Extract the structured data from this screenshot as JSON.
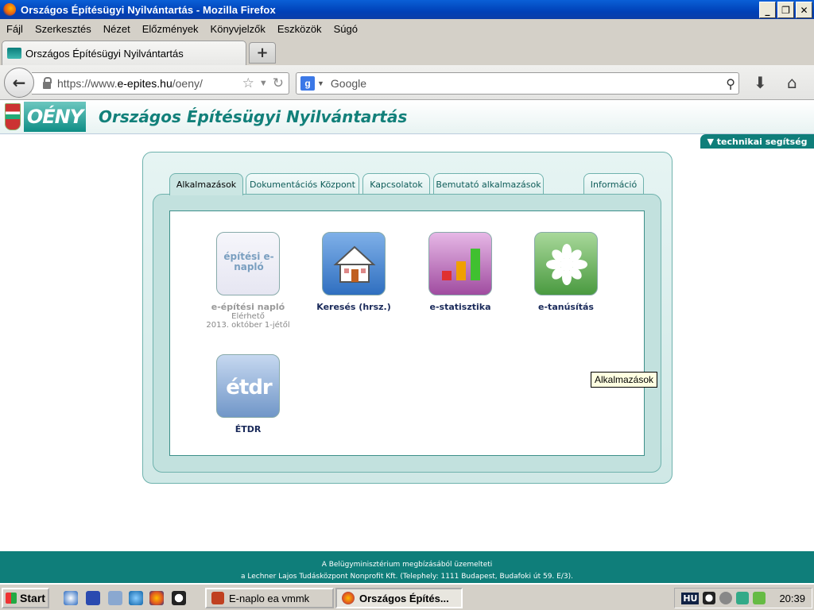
{
  "window": {
    "title": "Országos Építésügyi Nyilvántartás - Mozilla Firefox"
  },
  "menu": [
    "Fájl",
    "Szerkesztés",
    "Nézet",
    "Előzmények",
    "Könyvjelzők",
    "Eszközök",
    "Súgó"
  ],
  "tabs": {
    "active_title": "Országos Építésügyi Nyilvántartás",
    "new_tab": "+"
  },
  "address": {
    "proto": "https://www.",
    "host": "e-epites.hu",
    "path": "/oeny/"
  },
  "search": {
    "placeholder": "Google",
    "engine": "g"
  },
  "site": {
    "logo": "OÉNY",
    "title": "Országos Építésügyi Nyilvántartás",
    "help": "▼ technikai segítség"
  },
  "panel_tabs": [
    "Alkalmazások",
    "Dokumentációs Központ",
    "Kapcsolatok",
    "Bemutató alkalmazások",
    "Információ"
  ],
  "apps": [
    {
      "label": "e-építési napló",
      "sub1": "Elérhető",
      "sub2": "2013. október 1-jétől",
      "icon_text": "építési e-napló"
    },
    {
      "label": "Keresés (hrsz.)"
    },
    {
      "label": "e-statisztika"
    },
    {
      "label": "e-tanúsítás"
    },
    {
      "label": "ÉTDR",
      "icon_text": "étdr"
    }
  ],
  "tooltip": "Alkalmazások",
  "footer": {
    "line1": "A Belügyminisztérium megbízásából üzemelteti",
    "line2": "a Lechner Lajos Tudásközpont Nonprofit Kft. (Telephely: 1111 Budapest, Budafoki út 59. E/3)."
  },
  "taskbar": {
    "start": "Start",
    "tasks": [
      "E-naplo ea vmmk",
      "Országos Építés..."
    ],
    "lang": "HU",
    "clock": "20:39"
  },
  "colors": {
    "brand": "#0f7e7a",
    "accent": "#12807a"
  }
}
